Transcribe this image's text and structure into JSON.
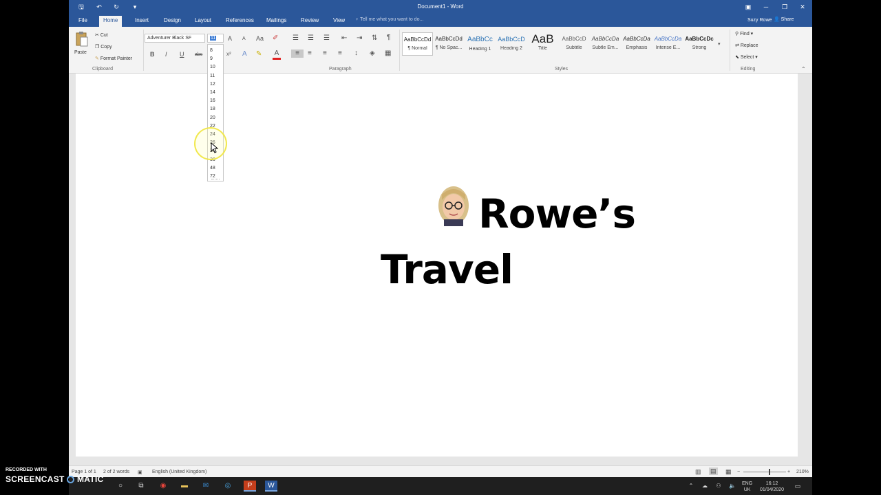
{
  "window": {
    "title": "Document1 - Word"
  },
  "tabs": [
    "File",
    "Home",
    "Insert",
    "Design",
    "Layout",
    "References",
    "Mailings",
    "Review",
    "View"
  ],
  "tell_me": "Tell me what you want to do...",
  "user": "Suzy Rowe",
  "share": "Share",
  "clipboard": {
    "paste": "Paste",
    "cut": "Cut",
    "copy": "Copy",
    "format_painter": "Format Painter",
    "label": "Clipboard"
  },
  "font": {
    "name": "Adventurer Black SF",
    "size": "11",
    "bold": "B",
    "italic": "I",
    "underline": "U",
    "strike": "abc",
    "superscript": "x²",
    "grow": "A",
    "shrink": "A",
    "case": "Aa"
  },
  "font_sizes": [
    "8",
    "9",
    "10",
    "11",
    "12",
    "14",
    "16",
    "18",
    "20",
    "22",
    "24",
    "26",
    "28",
    "36",
    "48",
    "72"
  ],
  "paragraph_label": "Paragraph",
  "styles": {
    "items": [
      {
        "sample": "AaBbCcDd",
        "label": "¶ Normal"
      },
      {
        "sample": "AaBbCcDd",
        "label": "¶ No Spac..."
      },
      {
        "sample": "AaBbCc",
        "label": "Heading 1"
      },
      {
        "sample": "AaBbCcD",
        "label": "Heading 2"
      },
      {
        "sample": "AaB",
        "label": "Title"
      },
      {
        "sample": "AaBbCcD",
        "label": "Subtitle"
      },
      {
        "sample": "AaBbCcDa",
        "label": "Subtle Em..."
      },
      {
        "sample": "AaBbCcDa",
        "label": "Emphasis"
      },
      {
        "sample": "AaBbCcDa",
        "label": "Intense E..."
      },
      {
        "sample": "AaBbCcDc",
        "label": "Strong"
      }
    ],
    "label": "Styles"
  },
  "editing": {
    "find": "Find",
    "replace": "Replace",
    "select": "Select",
    "label": "Editing"
  },
  "document": {
    "line1": "Rowe’s",
    "line2": "Travel"
  },
  "status": {
    "page": "Page 1 of 1",
    "words": "2 of 2 words",
    "language": "English (United Kingdom)",
    "zoom": "210%"
  },
  "taskbar": {
    "lang": "ENG",
    "region": "UK",
    "time": "16:12",
    "date": "01/04/2020"
  },
  "watermark": {
    "line1": "RECORDED WITH",
    "line2": "SCREENCAST",
    "line2b": "MATIC"
  },
  "colors": {
    "word_blue": "#2b579a",
    "ribbon_bg": "#f3f3f3",
    "highlight_ring": "#f0e63c"
  }
}
